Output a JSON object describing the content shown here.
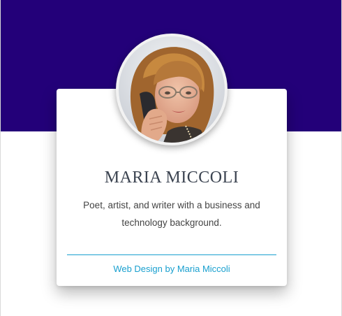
{
  "profile": {
    "name": "MARIA MICCOLI",
    "bio": "Poet, artist, and writer with a business and technology background.",
    "footer_link": "Web Design by Maria Miccoli"
  },
  "colors": {
    "banner": "#230079",
    "accent": "#1aa0cf",
    "name_text": "#3b4350"
  },
  "icons": {
    "avatar": "profile-photo"
  }
}
